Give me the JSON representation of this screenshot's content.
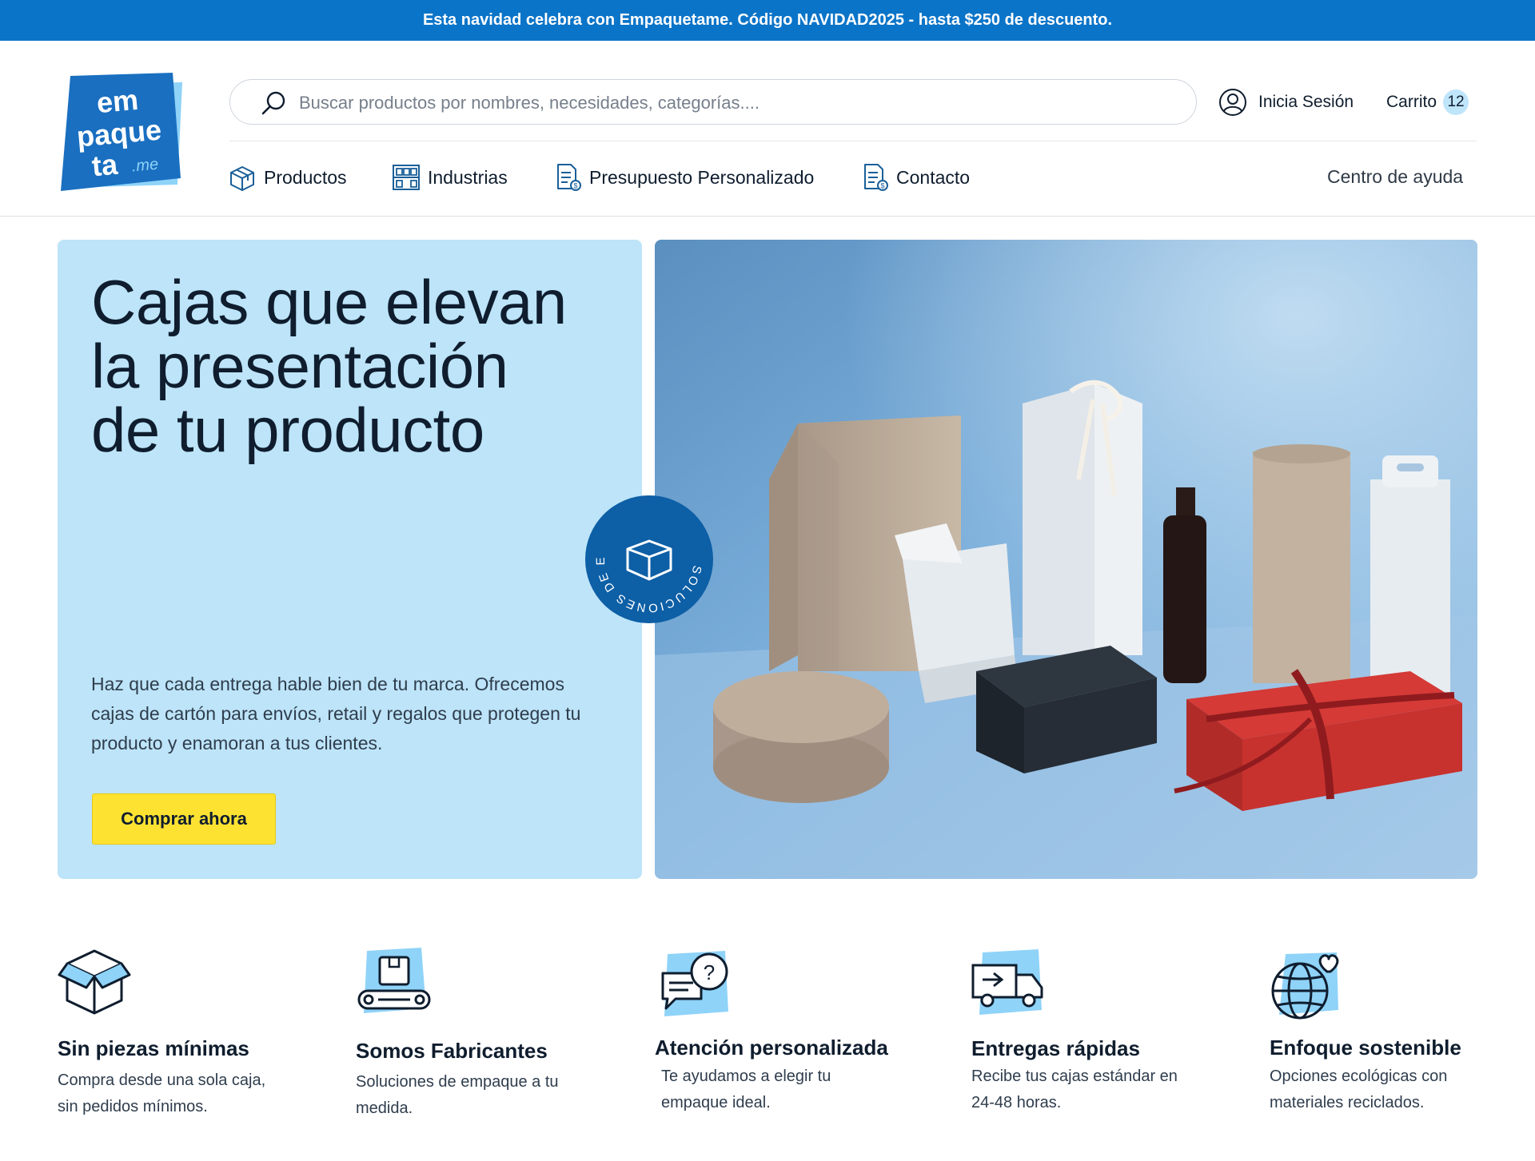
{
  "promo": {
    "text": "Esta navidad celebra con Empaquetame. Código NAVIDAD2025 - hasta $250 de descuento."
  },
  "logo": {
    "line1": "em",
    "line2": "paque",
    "line3": "ta",
    "suffix": ".me"
  },
  "search": {
    "placeholder": "Buscar productos por nombres, necesidades, categorías...."
  },
  "account": {
    "login_label": "Inicia Sesión"
  },
  "cart": {
    "label": "Carrito",
    "count": "12"
  },
  "nav": {
    "items": [
      {
        "label": "Productos",
        "icon": "box-icon"
      },
      {
        "label": "Industrias",
        "icon": "warehouse-icon"
      },
      {
        "label": "Presupuesto Personalizado",
        "icon": "quote-document-icon"
      },
      {
        "label": "Contacto",
        "icon": "contact-document-icon"
      }
    ],
    "help_label": "Centro de ayuda"
  },
  "hero": {
    "title_line1": "Cajas que elevan",
    "title_line2": "la presentación",
    "title_line3": "de tu producto",
    "description": "Haz que cada entrega hable bien de tu marca. Ofrecemos cajas de cartón para envíos, retail y regalos que protegen tu producto y enamoran a tus clientes.",
    "cta_label": "Comprar ahora",
    "seal_text": "SOLUCIONES DE EMPAQUE A TU MEDIDA"
  },
  "features": [
    {
      "title": "Sin piezas mínimas",
      "text": "Compra desde una sola caja, sin pedidos mínimos.",
      "icon": "open-box-icon"
    },
    {
      "title": "Somos Fabricantes",
      "text": "Soluciones de empaque a tu medida.",
      "icon": "conveyor-icon"
    },
    {
      "title": "Atención personalizada",
      "text": "Te ayudamos a elegir tu empaque ideal.",
      "icon": "chat-question-icon"
    },
    {
      "title": "Entregas rápidas",
      "text": "Recibe tus cajas estándar en 24-48 horas.",
      "icon": "delivery-truck-icon"
    },
    {
      "title": "Enfoque sostenible",
      "text": "Opciones ecológicas con materiales reciclados.",
      "icon": "globe-heart-icon"
    }
  ],
  "colors": {
    "brand_blue": "#0a74c8",
    "hero_bg": "#bde4f8",
    "cta_yellow": "#fde232",
    "icon_accent": "#8fd3f8"
  }
}
